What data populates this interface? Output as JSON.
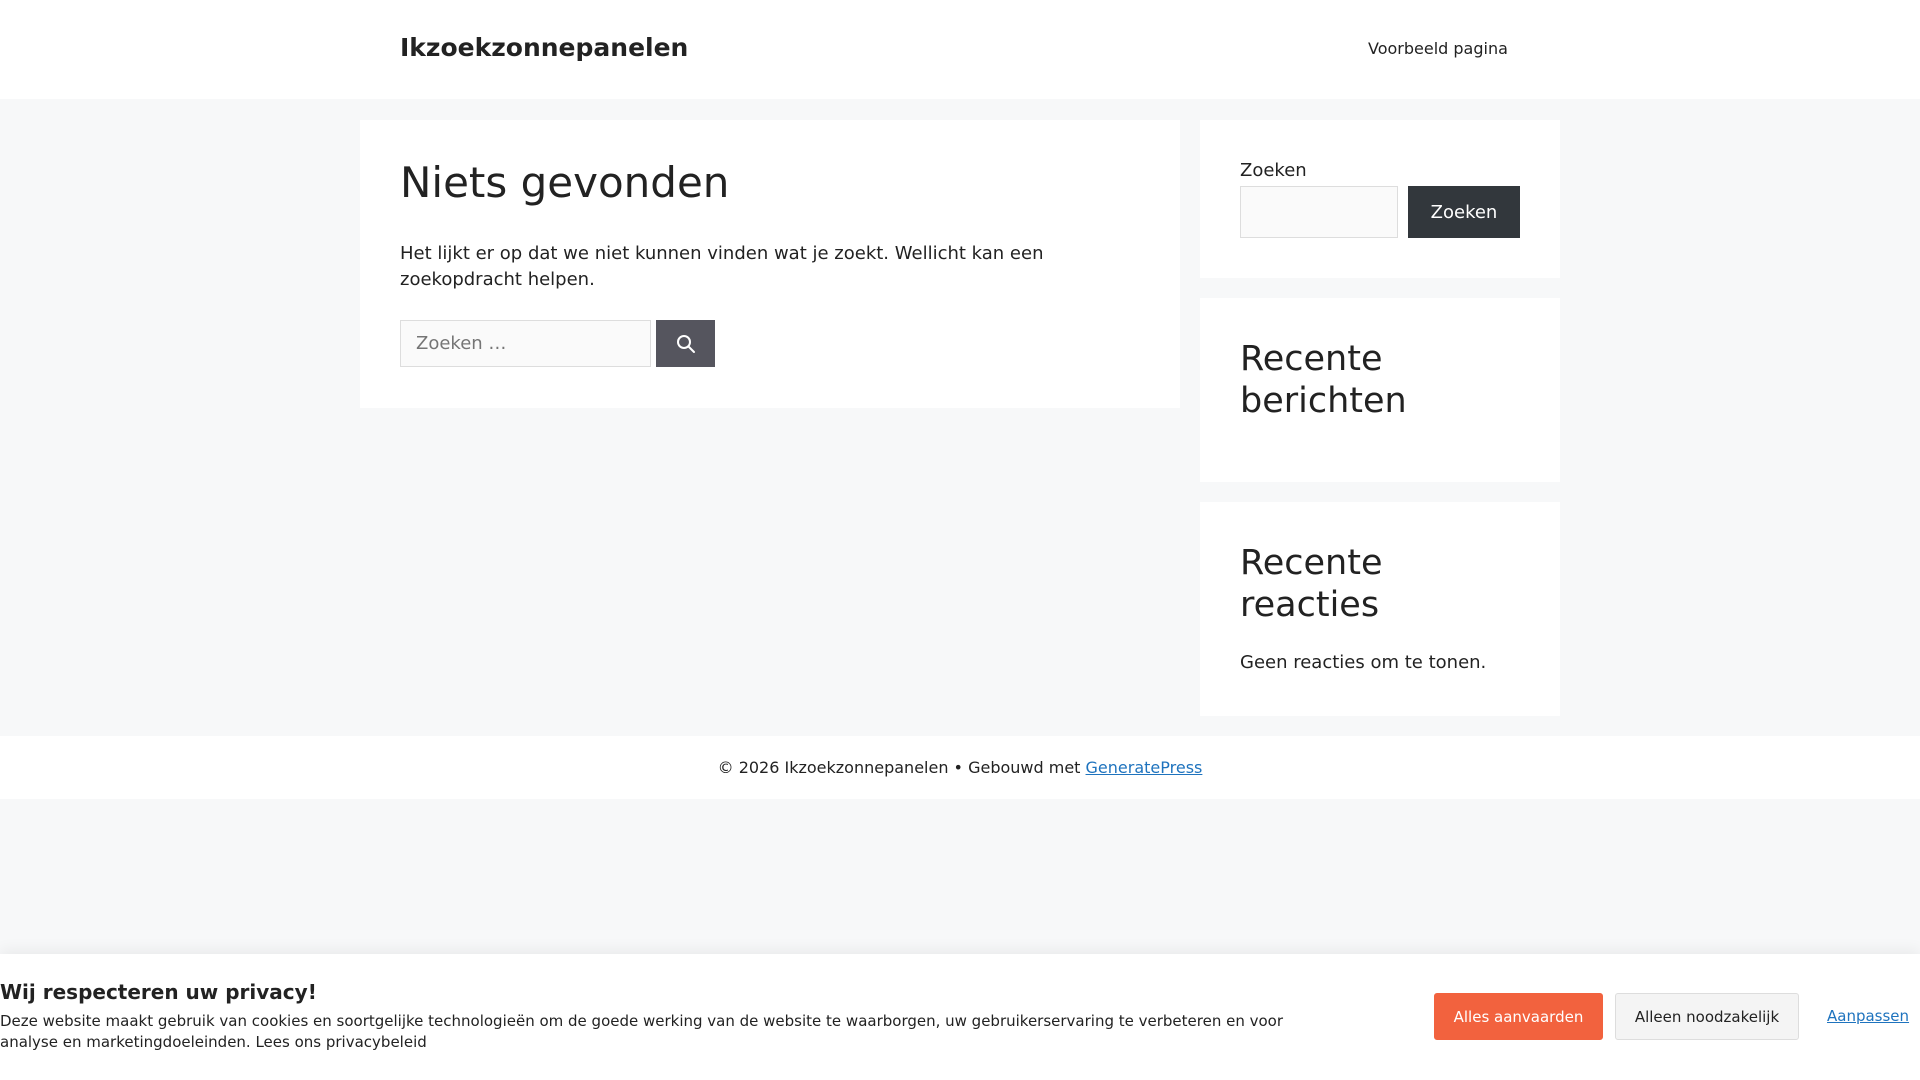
{
  "header": {
    "site_title": "Ikzoekzonnepanelen",
    "nav_item": "Voorbeeld pagina"
  },
  "main": {
    "title": "Niets gevonden",
    "text": "Het lijkt er op dat we niet kunnen vinden wat je zoekt. Wellicht kan een zoekopdracht helpen.",
    "search_placeholder": "Zoeken …",
    "search_icon": "search-icon"
  },
  "sidebar": {
    "search_label": "Zoeken",
    "search_button": "Zoeken",
    "recent_posts_title": "Recente berichten",
    "recent_comments_title": "Recente reacties",
    "no_comments_text": "Geen reacties om te tonen."
  },
  "footer": {
    "text": "© 2026 Ikzoekzonnepanelen • Gebouwd met ",
    "link": "GeneratePress"
  },
  "cookie": {
    "title": "Wij respecteren uw privacy!",
    "text": "Deze website maakt gebruik van cookies en soortgelijke technologieën om de goede werking van de website te waarborgen, uw gebruikerservaring te verbeteren en voor analyse en marketingdoeleinden. Lees ons privacybeleid",
    "accept_all": "Alles aanvaarden",
    "necessary_only": "Alleen noodzakelijk",
    "customize": "Aanpassen"
  },
  "colors": {
    "accent": "#f2623e",
    "link": "#1e73be",
    "dark_button": "#32373c",
    "background": "#f7f8f9"
  }
}
